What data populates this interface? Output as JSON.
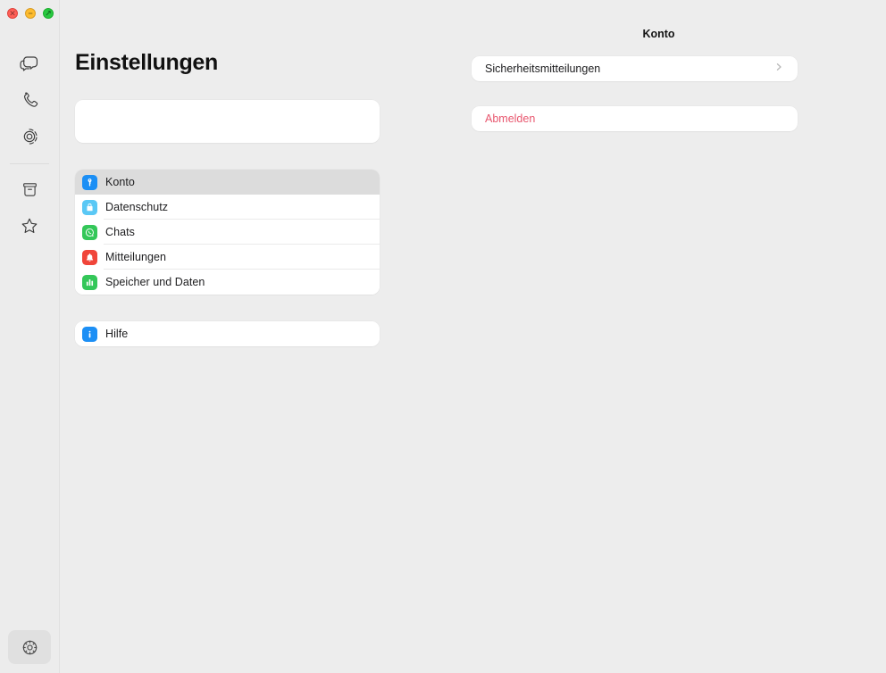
{
  "window": {
    "traffic_lights": [
      {
        "name": "close",
        "glyph": "✕",
        "color": "#ff5f57"
      },
      {
        "name": "minimize",
        "glyph": "−",
        "color": "#febc2e"
      },
      {
        "name": "maximize",
        "glyph": "↗",
        "color": "#28c840"
      }
    ]
  },
  "rail": {
    "items": [
      {
        "icon": "chats-icon",
        "label": "Chats"
      },
      {
        "icon": "calls-icon",
        "label": "Anrufe"
      },
      {
        "icon": "status-icon",
        "label": "Status"
      }
    ],
    "items_lower": [
      {
        "icon": "archive-icon",
        "label": "Archiviert"
      },
      {
        "icon": "starred-icon",
        "label": "Mit Stern"
      }
    ],
    "bottom": {
      "icon": "settings-gear-icon",
      "label": "Einstellungen"
    }
  },
  "settings": {
    "title": "Einstellungen",
    "profile_card": {
      "name": "",
      "status": ""
    },
    "items": [
      {
        "label": "Konto",
        "icon": "key-icon",
        "color": "#1c8ff5",
        "selected": true
      },
      {
        "label": "Datenschutz",
        "icon": "lock-icon",
        "color": "#5ac8f5",
        "selected": false
      },
      {
        "label": "Chats",
        "icon": "chat-bubble-icon",
        "color": "#34c759",
        "selected": false
      },
      {
        "label": "Mitteilungen",
        "icon": "bell-icon",
        "color": "#f0453a",
        "selected": false
      },
      {
        "label": "Speicher und Daten",
        "icon": "bar-chart-icon",
        "color": "#34c759",
        "selected": false
      }
    ],
    "help": {
      "label": "Hilfe",
      "icon": "info-icon",
      "color": "#1c8ff5"
    }
  },
  "detail": {
    "title": "Konto",
    "rows": [
      {
        "label": "Sicherheitsmitteilungen",
        "chevron": "chevron-right-icon",
        "danger": false
      }
    ],
    "actions": [
      {
        "label": "Abmelden",
        "danger": true
      }
    ],
    "danger_color": "#e8566e"
  }
}
